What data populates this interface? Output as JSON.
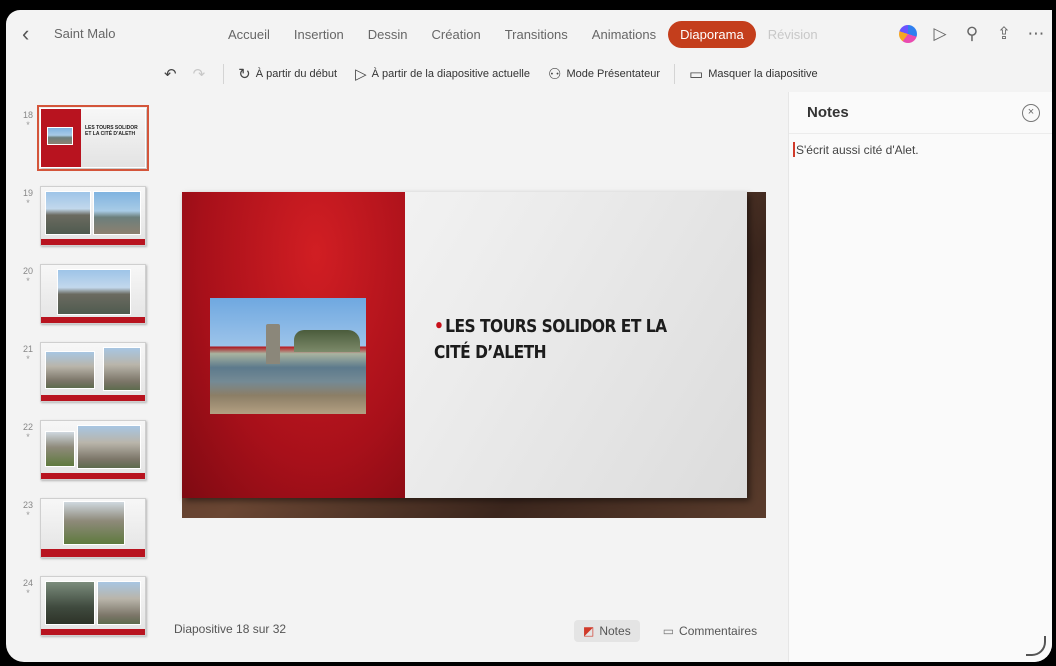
{
  "app": {
    "document_title": "Saint Malo",
    "tabs": [
      "Accueil",
      "Insertion",
      "Dessin",
      "Création",
      "Transitions",
      "Animations",
      "Diaporama",
      "Révision"
    ],
    "active_tab": "Diaporama",
    "accent_color": "#c43e1c"
  },
  "ribbon": {
    "start_beginning": "À partir du début",
    "start_current": "À partir de la diapositive actuelle",
    "presenter_mode": "Mode Présentateur",
    "hide_slide": "Masquer la diapositive"
  },
  "thumbnails": [
    {
      "number": "18",
      "star": "*",
      "selected": true
    },
    {
      "number": "19",
      "star": "*"
    },
    {
      "number": "20",
      "star": "*"
    },
    {
      "number": "21",
      "star": "*"
    },
    {
      "number": "22",
      "star": "*"
    },
    {
      "number": "23",
      "star": "*"
    },
    {
      "number": "24",
      "star": "*"
    }
  ],
  "slide": {
    "bullet": "•",
    "title": "LES TOURS SOLIDOR ET LA CITÉ D’ALETH"
  },
  "status": {
    "slide_counter": "Diapositive 18 sur 32",
    "notes_button": "Notes",
    "comments_button": "Commentaires"
  },
  "notes": {
    "title": "Notes",
    "text": "S'écrit aussi cité d'Alet."
  }
}
